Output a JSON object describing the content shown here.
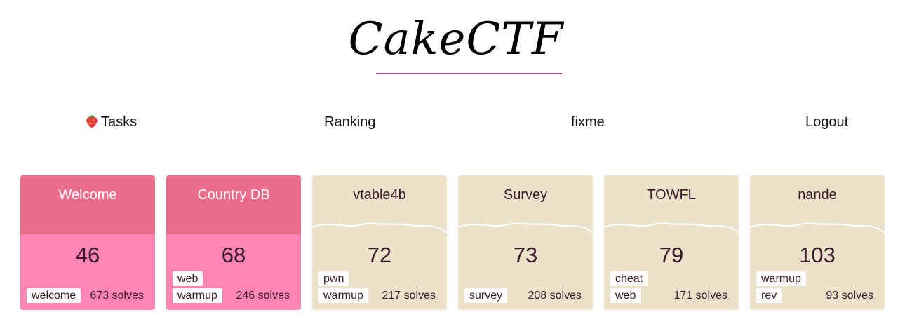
{
  "site": {
    "logo": "CakeCTF",
    "accent_color": "#b8478f"
  },
  "nav": {
    "tasks_icon": "strawberry-icon",
    "tasks": "Tasks",
    "ranking": "Ranking",
    "user": "fixme",
    "logout": "Logout"
  },
  "colors": {
    "solved_bg": "#ff85b3",
    "solved_top": "#ec6c8c",
    "unsolved_bg": "#ece1c9"
  },
  "tasks": [
    {
      "name": "Welcome",
      "score": "46",
      "solved": true,
      "tags": [
        "welcome"
      ],
      "solves": "673 solves"
    },
    {
      "name": "Country DB",
      "score": "68",
      "solved": true,
      "tags": [
        "web",
        "warmup"
      ],
      "solves": "246 solves"
    },
    {
      "name": "vtable4b",
      "score": "72",
      "solved": false,
      "tags": [
        "pwn",
        "warmup"
      ],
      "solves": "217 solves"
    },
    {
      "name": "Survey",
      "score": "73",
      "solved": false,
      "tags": [
        "survey"
      ],
      "solves": "208 solves"
    },
    {
      "name": "TOWFL",
      "score": "79",
      "solved": false,
      "tags": [
        "cheat",
        "web"
      ],
      "solves": "171 solves"
    },
    {
      "name": "nande",
      "score": "103",
      "solved": false,
      "tags": [
        "warmup",
        "rev"
      ],
      "solves": "93 solves"
    }
  ]
}
